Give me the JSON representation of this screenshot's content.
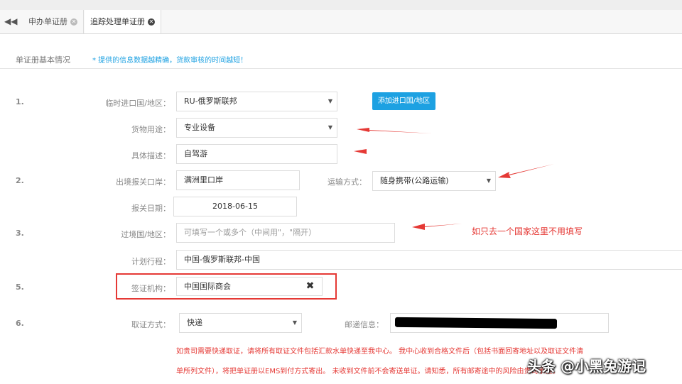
{
  "tabs": [
    {
      "label": "申办单证册",
      "active": false
    },
    {
      "label": "追踪处理单证册",
      "active": true
    }
  ],
  "section": {
    "title": "单证册基本情况",
    "hint": "* 提供的信息数据越精确，货款审核的时间越短！"
  },
  "rows": {
    "r1_num": "1.",
    "country_label": "临时进口国/地区：",
    "country_value": "RU-俄罗斯联邦",
    "add_country_button": "添加进口国/地区",
    "purpose_label": "货物用途：",
    "purpose_value": "专业设备",
    "desc_label": "具体描述：",
    "desc_value": "自驾游",
    "r2_num": "2.",
    "port_label": "出境报关口岸：",
    "port_value": "满洲里口岸",
    "transport_label": "运输方式：",
    "transport_value": "随身携带(公路运输)",
    "date_label": "报关日期：",
    "date_value": "2018-06-15",
    "r3_num": "3.",
    "transit_label": "过境国/地区：",
    "transit_placeholder": "可填写一个或多个（中间用\"，\"隔开）",
    "plan_label": "计划行程：",
    "plan_value": "中国-俄罗斯联邦-中国",
    "r5_num": "5.",
    "agency_label": "签证机构：",
    "agency_value": "中国国际商会",
    "r6_num": "6.",
    "method_label": "取证方式：",
    "method_value": "快递",
    "mail_label": "邮递信息："
  },
  "annotation": {
    "text": "如只去一个国家这里不用填写",
    "color": "#e53935"
  },
  "notes": {
    "line1": "如贵司需要快递取证，请将所有取证文件包括汇款水单快递至我中心。 我中心收到合格文件后（包括书面回寄地址以及取证文件清",
    "line2": "单所列文件），将把单证册以EMS到付方式寄出。 未收到文件前不会寄送单证。请知悉，所有邮寄途中的风险由贵司承担。"
  },
  "watermark": "头条 @小黑兔游记",
  "colors": {
    "accent": "#1da1e2",
    "annotation_red": "#e53935"
  },
  "icons": {
    "back": "double-left-chevron",
    "tab_close": "circle-x",
    "clear": "x-mark",
    "dropdown": "caret-down"
  }
}
